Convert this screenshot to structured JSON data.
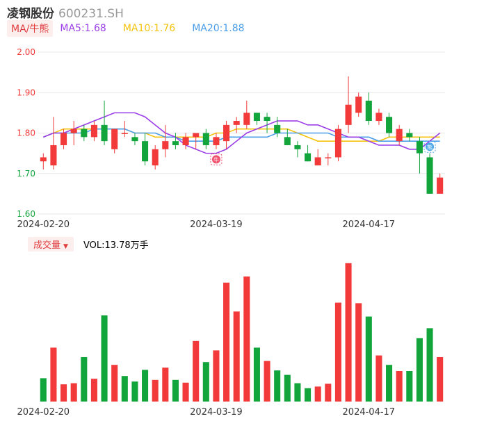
{
  "header": {
    "stock_name": "凌钢股份",
    "stock_code": "600231.SH"
  },
  "ma_legend": {
    "badge": "MA/牛熊",
    "ma5": "MA5:1.68",
    "ma10": "MA10:1.76",
    "ma20": "MA20:1.88"
  },
  "volume_legend": {
    "badge": "成交量",
    "value": "VOL:13.78万手"
  },
  "markers": {
    "bull": "牛",
    "bear": "熊"
  },
  "colors": {
    "up": "#f23a3a",
    "down": "#12a53c",
    "ma5": "#9b3ee8",
    "ma10": "#f5c30c",
    "ma20": "#4a9de8",
    "grid": "#e8e8e8"
  },
  "chart_data": [
    {
      "type": "candlestick",
      "y_ticks": [
        "2.00",
        "1.90",
        "1.80",
        "1.70",
        "1.60"
      ],
      "ylim": [
        1.6,
        2.0
      ],
      "x_tick_labels": [
        {
          "index": 0,
          "label": "2024-02-20"
        },
        {
          "index": 17,
          "label": "2024-03-19"
        },
        {
          "index": 32,
          "label": "2024-04-17"
        }
      ],
      "candles": [
        {
          "o": 1.73,
          "c": 1.74,
          "h": 1.75,
          "l": 1.71
        },
        {
          "o": 1.72,
          "c": 1.77,
          "h": 1.84,
          "l": 1.71
        },
        {
          "o": 1.77,
          "c": 1.8,
          "h": 1.81,
          "l": 1.76
        },
        {
          "o": 1.8,
          "c": 1.81,
          "h": 1.83,
          "l": 1.77
        },
        {
          "o": 1.81,
          "c": 1.79,
          "h": 1.82,
          "l": 1.78
        },
        {
          "o": 1.79,
          "c": 1.82,
          "h": 1.83,
          "l": 1.78
        },
        {
          "o": 1.82,
          "c": 1.78,
          "h": 1.88,
          "l": 1.77
        },
        {
          "o": 1.76,
          "c": 1.81,
          "h": 1.81,
          "l": 1.75
        },
        {
          "o": 1.8,
          "c": 1.8,
          "h": 1.83,
          "l": 1.79
        },
        {
          "o": 1.79,
          "c": 1.78,
          "h": 1.8,
          "l": 1.77
        },
        {
          "o": 1.78,
          "c": 1.73,
          "h": 1.8,
          "l": 1.72
        },
        {
          "o": 1.72,
          "c": 1.76,
          "h": 1.77,
          "l": 1.71
        },
        {
          "o": 1.76,
          "c": 1.78,
          "h": 1.82,
          "l": 1.74
        },
        {
          "o": 1.78,
          "c": 1.77,
          "h": 1.8,
          "l": 1.76
        },
        {
          "o": 1.77,
          "c": 1.79,
          "h": 1.8,
          "l": 1.76
        },
        {
          "o": 1.79,
          "c": 1.8,
          "h": 1.8,
          "l": 1.76
        },
        {
          "o": 1.8,
          "c": 1.77,
          "h": 1.81,
          "l": 1.76
        },
        {
          "o": 1.77,
          "c": 1.79,
          "h": 1.8,
          "l": 1.76
        },
        {
          "o": 1.78,
          "c": 1.82,
          "h": 1.83,
          "l": 1.76
        },
        {
          "o": 1.82,
          "c": 1.83,
          "h": 1.84,
          "l": 1.8
        },
        {
          "o": 1.82,
          "c": 1.85,
          "h": 1.88,
          "l": 1.81
        },
        {
          "o": 1.85,
          "c": 1.83,
          "h": 1.85,
          "l": 1.82
        },
        {
          "o": 1.84,
          "c": 1.83,
          "h": 1.85,
          "l": 1.8
        },
        {
          "o": 1.82,
          "c": 1.8,
          "h": 1.84,
          "l": 1.79
        },
        {
          "o": 1.79,
          "c": 1.77,
          "h": 1.81,
          "l": 1.77
        },
        {
          "o": 1.77,
          "c": 1.76,
          "h": 1.78,
          "l": 1.74
        },
        {
          "o": 1.75,
          "c": 1.73,
          "h": 1.77,
          "l": 1.73
        },
        {
          "o": 1.72,
          "c": 1.74,
          "h": 1.76,
          "l": 1.72
        },
        {
          "o": 1.74,
          "c": 1.74,
          "h": 1.75,
          "l": 1.72
        },
        {
          "o": 1.74,
          "c": 1.81,
          "h": 1.82,
          "l": 1.73
        },
        {
          "o": 1.82,
          "c": 1.87,
          "h": 1.94,
          "l": 1.8
        },
        {
          "o": 1.85,
          "c": 1.89,
          "h": 1.9,
          "l": 1.84
        },
        {
          "o": 1.88,
          "c": 1.83,
          "h": 1.9,
          "l": 1.82
        },
        {
          "o": 1.83,
          "c": 1.85,
          "h": 1.86,
          "l": 1.82
        },
        {
          "o": 1.84,
          "c": 1.8,
          "h": 1.85,
          "l": 1.79
        },
        {
          "o": 1.78,
          "c": 1.81,
          "h": 1.82,
          "l": 1.77
        },
        {
          "o": 1.8,
          "c": 1.79,
          "h": 1.81,
          "l": 1.78
        },
        {
          "o": 1.78,
          "c": 1.75,
          "h": 1.79,
          "l": 1.7
        },
        {
          "o": 1.74,
          "c": 1.65,
          "h": 1.75,
          "l": 1.65
        },
        {
          "o": 1.65,
          "c": 1.69,
          "h": 1.7,
          "l": 1.65
        }
      ],
      "ma5": [
        1.79,
        1.8,
        1.8,
        1.81,
        1.82,
        1.83,
        1.84,
        1.85,
        1.85,
        1.85,
        1.84,
        1.82,
        1.8,
        1.79,
        1.77,
        1.76,
        1.75,
        1.75,
        1.76,
        1.78,
        1.8,
        1.81,
        1.82,
        1.83,
        1.83,
        1.83,
        1.82,
        1.82,
        1.81,
        1.8,
        1.79,
        1.79,
        1.78,
        1.77,
        1.77,
        1.77,
        1.76,
        1.76,
        1.78,
        1.8
      ],
      "ma10": [
        1.79,
        1.8,
        1.81,
        1.81,
        1.81,
        1.81,
        1.81,
        1.81,
        1.81,
        1.8,
        1.8,
        1.79,
        1.79,
        1.79,
        1.79,
        1.79,
        1.79,
        1.8,
        1.8,
        1.81,
        1.81,
        1.81,
        1.81,
        1.81,
        1.81,
        1.8,
        1.79,
        1.78,
        1.78,
        1.78,
        1.78,
        1.78,
        1.78,
        1.78,
        1.79,
        1.79,
        1.79,
        1.79,
        1.79,
        1.79
      ],
      "ma20": [
        1.79,
        1.8,
        1.8,
        1.8,
        1.8,
        1.81,
        1.81,
        1.81,
        1.81,
        1.8,
        1.8,
        1.8,
        1.79,
        1.79,
        1.78,
        1.78,
        1.78,
        1.78,
        1.79,
        1.79,
        1.79,
        1.79,
        1.79,
        1.8,
        1.8,
        1.8,
        1.8,
        1.8,
        1.8,
        1.79,
        1.79,
        1.79,
        1.79,
        1.78,
        1.78,
        1.78,
        1.78,
        1.78,
        1.78,
        1.78
      ]
    },
    {
      "type": "bar",
      "title": "成交量",
      "unit": "万手",
      "values": [
        {
          "v": 4.2,
          "up": false
        },
        {
          "v": 9.7,
          "up": true
        },
        {
          "v": 3.1,
          "up": true
        },
        {
          "v": 3.3,
          "up": true
        },
        {
          "v": 8.0,
          "up": false
        },
        {
          "v": 4.1,
          "up": true
        },
        {
          "v": 15.5,
          "up": false
        },
        {
          "v": 6.6,
          "up": true
        },
        {
          "v": 4.6,
          "up": false
        },
        {
          "v": 3.6,
          "up": false
        },
        {
          "v": 5.7,
          "up": false
        },
        {
          "v": 3.9,
          "up": true
        },
        {
          "v": 6.1,
          "up": true
        },
        {
          "v": 3.9,
          "up": false
        },
        {
          "v": 3.4,
          "up": true
        },
        {
          "v": 10.9,
          "up": true
        },
        {
          "v": 7.1,
          "up": false
        },
        {
          "v": 9.2,
          "up": true
        },
        {
          "v": 21.4,
          "up": true
        },
        {
          "v": 16.2,
          "up": true
        },
        {
          "v": 22.5,
          "up": true
        },
        {
          "v": 9.7,
          "up": false
        },
        {
          "v": 7.3,
          "up": true
        },
        {
          "v": 5.6,
          "up": false
        },
        {
          "v": 4.8,
          "up": false
        },
        {
          "v": 3.3,
          "up": false
        },
        {
          "v": 2.4,
          "up": false
        },
        {
          "v": 2.7,
          "up": true
        },
        {
          "v": 3.2,
          "up": true
        },
        {
          "v": 17.8,
          "up": true
        },
        {
          "v": 24.9,
          "up": true
        },
        {
          "v": 17.7,
          "up": true
        },
        {
          "v": 15.3,
          "up": false
        },
        {
          "v": 8.3,
          "up": true
        },
        {
          "v": 6.6,
          "up": false
        },
        {
          "v": 5.5,
          "up": true
        },
        {
          "v": 5.5,
          "up": false
        },
        {
          "v": 11.4,
          "up": false
        },
        {
          "v": 13.2,
          "up": false
        },
        {
          "v": 8.0,
          "up": true
        }
      ],
      "ymax": 26
    }
  ]
}
